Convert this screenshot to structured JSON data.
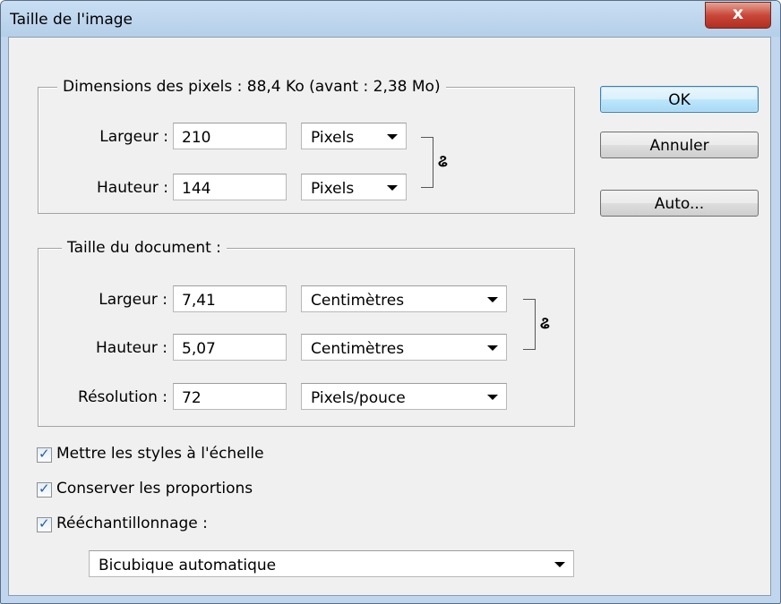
{
  "window": {
    "title": "Taille de l'image",
    "close_label": "x"
  },
  "pixel_dimensions": {
    "legend": "Dimensions des pixels : 88,4 Ko (avant : 2,38 Mo)",
    "width_label": "Largeur :",
    "width_value": "210",
    "width_unit": "Pixels",
    "height_label": "Hauteur :",
    "height_value": "144",
    "height_unit": "Pixels"
  },
  "document_size": {
    "legend": "Taille du document :",
    "width_label": "Largeur :",
    "width_value": "7,41",
    "width_unit": "Centimètres",
    "height_label": "Hauteur :",
    "height_value": "5,07",
    "height_unit": "Centimètres",
    "resolution_label": "Résolution :",
    "resolution_value": "72",
    "resolution_unit": "Pixels/pouce"
  },
  "buttons": {
    "ok": "OK",
    "cancel": "Annuler",
    "auto": "Auto..."
  },
  "options": {
    "scale_styles": {
      "label": "Mettre les styles à l'échelle",
      "checked": true
    },
    "constrain": {
      "label": "Conserver les proportions",
      "checked": true
    },
    "resample": {
      "label": "Rééchantillonnage :",
      "checked": true
    },
    "resample_method": "Bicubique automatique"
  },
  "icons": {
    "link": "chain-link-icon",
    "check": "checkmark-icon",
    "dropdown": "triangle-down-icon"
  }
}
